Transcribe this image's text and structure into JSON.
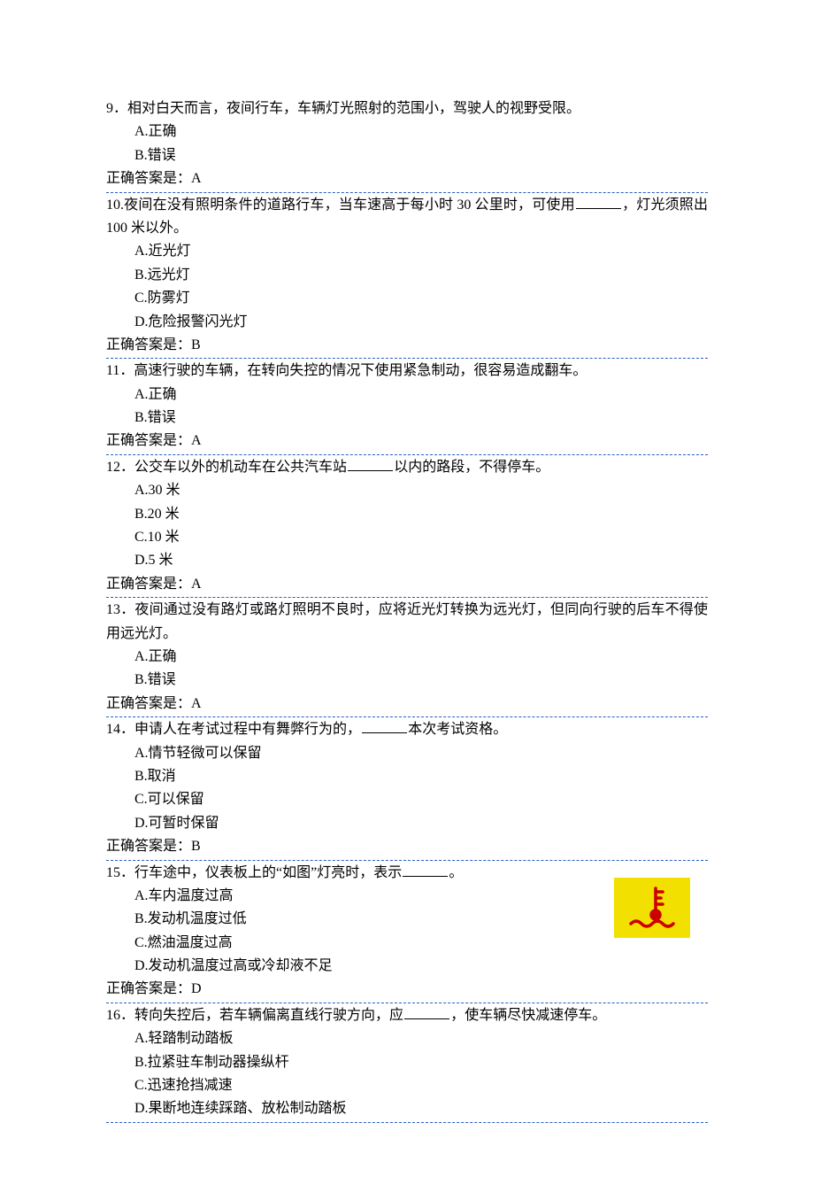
{
  "questions": [
    {
      "num": "9．",
      "text": "相对白天而言，夜间行车，车辆灯光照射的范围小，驾驶人的视野受限。",
      "options": [
        "A.正确",
        "B.错误"
      ],
      "answer": "正确答案是：A"
    },
    {
      "num": "10.",
      "text_pre": "夜间在没有照明条件的道路行车，当车速高于每小时 30 公里时，可使用",
      "text_post": "，灯光须照出 100 米以外。",
      "options": [
        "A.近光灯",
        "B.远光灯",
        "C.防雾灯",
        "D.危险报警闪光灯"
      ],
      "answer": "正确答案是：B"
    },
    {
      "num": "11．",
      "text": "高速行驶的车辆，在转向失控的情况下使用紧急制动，很容易造成翻车。",
      "options": [
        "A.正确",
        "B.错误"
      ],
      "answer": "正确答案是：A"
    },
    {
      "num": "12．",
      "text_pre": "公交车以外的机动车在公共汽车站",
      "text_post": "以内的路段，不得停车。",
      "options": [
        "A.30 米",
        "B.20 米",
        "C.10 米",
        "D.5 米"
      ],
      "answer": "正确答案是：A"
    },
    {
      "num": "13．",
      "text": "夜间通过没有路灯或路灯照明不良时，应将近光灯转换为远光灯，但同向行驶的后车不得使用远光灯。",
      "options": [
        "A.正确",
        "B.错误"
      ],
      "answer": "正确答案是：A"
    },
    {
      "num": "14．",
      "text_pre": "申请人在考试过程中有舞弊行为的，",
      "text_post": "本次考试资格。",
      "options": [
        "A.情节轻微可以保留",
        "B.取消",
        "C.可以保留",
        "D.可暂时保留"
      ],
      "answer": "正确答案是：B"
    },
    {
      "num": "15．",
      "text_pre": "行车途中，仪表板上的“如图”灯亮时，表示",
      "text_post": "。",
      "options": [
        "A.车内温度过高",
        "B.发动机温度过低",
        "C.燃油温度过高",
        "D.发动机温度过高或冷却液不足"
      ],
      "answer": "正确答案是：D",
      "has_icon": true,
      "icon_name": "engine-temperature-icon"
    },
    {
      "num": "16．",
      "text_pre": "转向失控后，若车辆偏离直线行驶方向，应",
      "text_post": "，使车辆尽快减速停车。",
      "options": [
        "A.轻踏制动踏板",
        "B.拉紧驻车制动器操纵杆",
        "C.迅速抢挡减速",
        "D.果断地连续踩踏、放松制动踏板"
      ],
      "answer": ""
    }
  ]
}
